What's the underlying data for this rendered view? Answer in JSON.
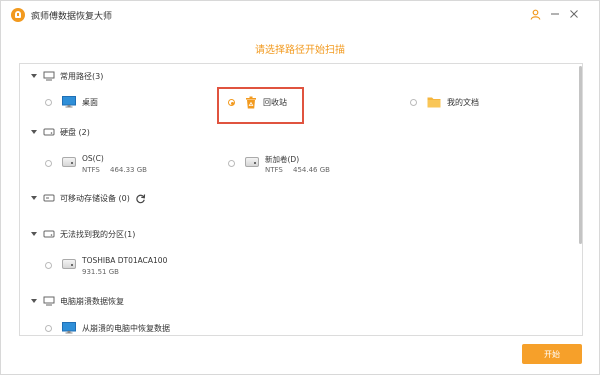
{
  "window": {
    "title": "疯师傅数据恢复大师"
  },
  "page": {
    "title": "请选择路径开始扫描"
  },
  "sections": {
    "common": {
      "label": "常用路径(3)",
      "items": {
        "desktop": {
          "label": "桌面"
        },
        "recycle": {
          "label": "回收站",
          "selected": true
        },
        "docs": {
          "label": "我的文档"
        }
      }
    },
    "disks": {
      "label": "硬盘 (2)",
      "drives": {
        "os": {
          "name": "OS(C)",
          "fs": "NTFS",
          "size": "464.33 GB"
        },
        "newvol": {
          "name": "新加卷(D)",
          "fs": "NTFS",
          "size": "454.46 GB"
        }
      }
    },
    "removable": {
      "label": "可移动存储设备 (0)"
    },
    "lost": {
      "label": "无法找到我的分区(1)",
      "drives": {
        "toshiba": {
          "name": "TOSHIBA DT01ACA100",
          "size": "931.51 GB"
        }
      }
    },
    "crash": {
      "label": "电脑崩溃数据恢复",
      "items": {
        "recover": {
          "label": "从崩溃的电脑中恢复数据"
        }
      }
    }
  },
  "buttons": {
    "start": "开始"
  },
  "colors": {
    "accent": "#f29a1f",
    "highlight": "#e0533f",
    "folder": "#f5b53d",
    "monitor": "#2f8fd8"
  }
}
